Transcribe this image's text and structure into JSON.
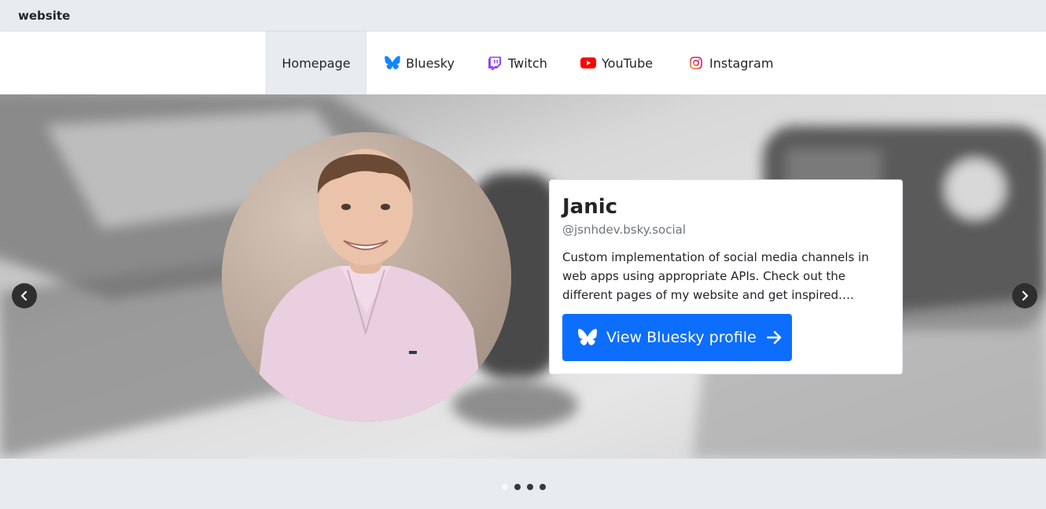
{
  "brand": "website",
  "nav": {
    "items": [
      {
        "label": "Homepage",
        "icon": "home"
      },
      {
        "label": "Bluesky",
        "icon": "butterfly-icon",
        "color": "#1185fe"
      },
      {
        "label": "Twitch",
        "icon": "twitch-icon",
        "color": "#9146ff"
      },
      {
        "label": "YouTube",
        "icon": "youtube-icon",
        "color": "#ff0000"
      },
      {
        "label": "Instagram",
        "icon": "instagram-icon",
        "color": "#e1306c"
      }
    ],
    "active": "Homepage"
  },
  "profile": {
    "name": "Janic",
    "handle": "@jsnhdev.bsky.social",
    "description": "Custom implementation of social media channels in web apps using appropriate APIs. Check out the different pages of my website and get inspired….",
    "button_label": "View Bluesky profile",
    "button_color": "#0d6efd"
  },
  "carousel": {
    "slide_count": 4,
    "active_index": 0
  }
}
